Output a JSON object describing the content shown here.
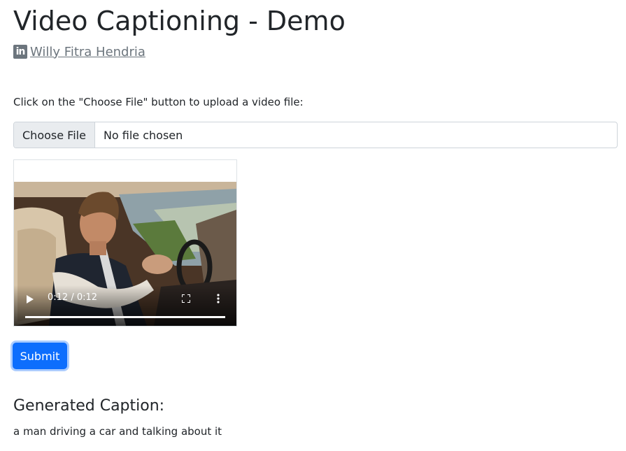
{
  "header": {
    "title": "Video Captioning - Demo",
    "author_name": "Willy Fitra Hendria",
    "author_icon": "linkedin-icon",
    "author_icon_glyph": "in"
  },
  "upload": {
    "instruction": "Click on the \"Choose File\" button to upload a video file:",
    "choose_file_label": "Choose File",
    "file_status": "No file chosen"
  },
  "video": {
    "time_display": "0:12 / 0:12",
    "progress_fraction": 1.0,
    "play_icon": "play-icon",
    "fullscreen_icon": "fullscreen-icon",
    "more_icon": "more-options-icon"
  },
  "actions": {
    "submit_label": "Submit",
    "accent_color": "#0d6efd"
  },
  "result": {
    "heading": "Generated Caption:",
    "caption": "a man driving a car and talking about it"
  }
}
